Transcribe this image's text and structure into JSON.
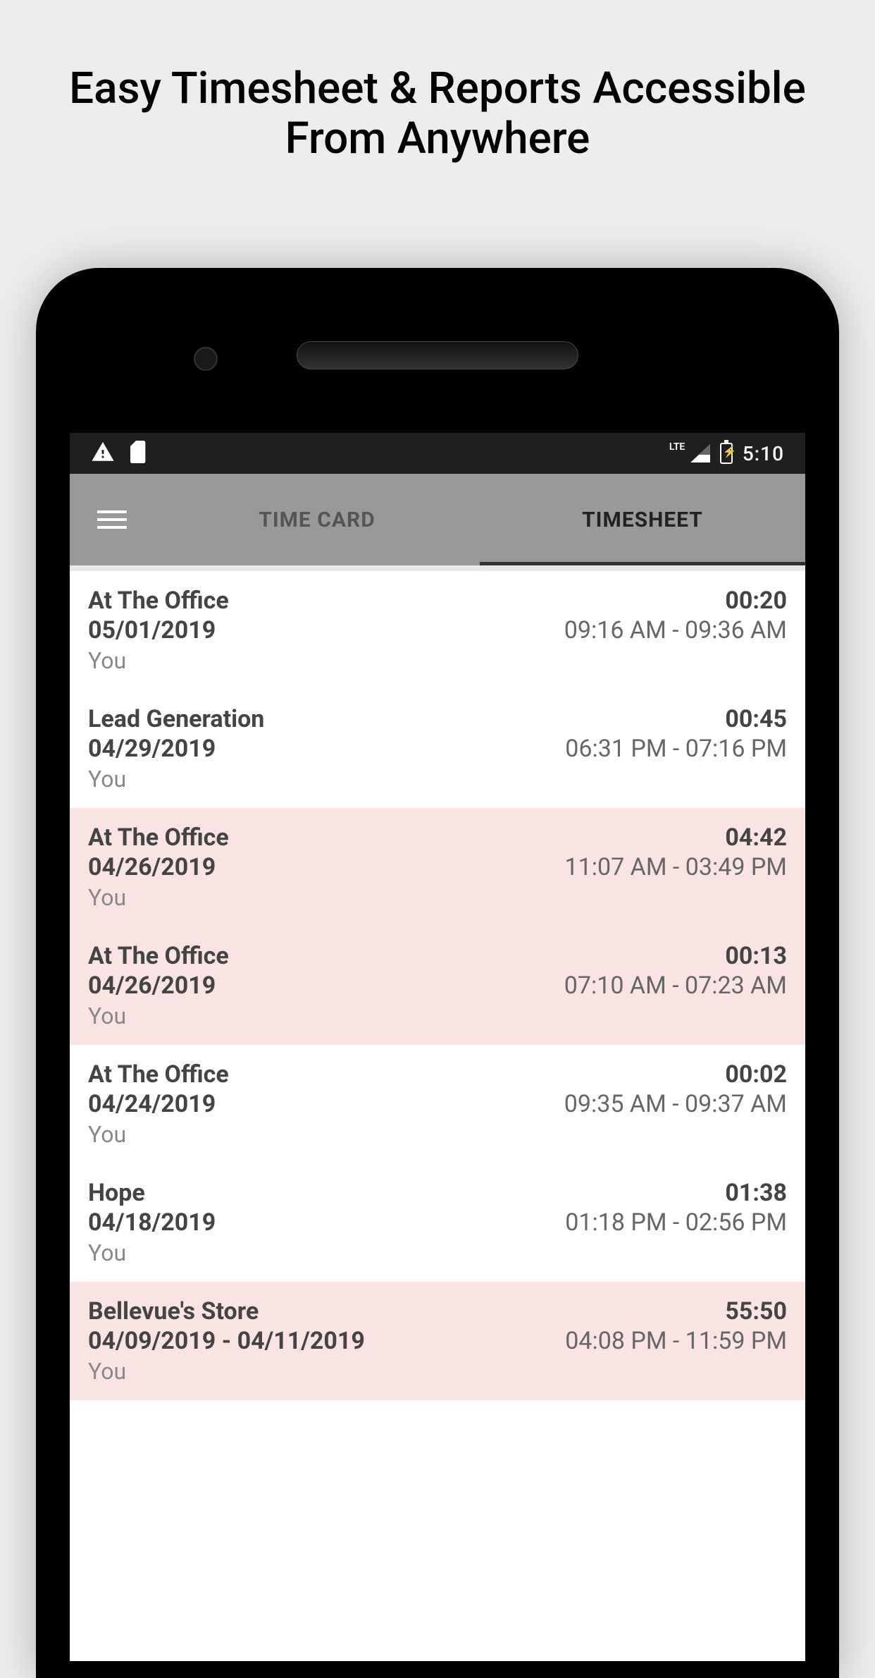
{
  "headline": "Easy Timesheet & Reports Accessible From Anywhere",
  "status_bar": {
    "clock": "5:10",
    "lte": "LTE"
  },
  "tabs": {
    "timecard": "TIME CARD",
    "timesheet": "TIMESHEET"
  },
  "entries": [
    {
      "title": "At The Office",
      "date": "05/01/2019",
      "user": "You",
      "duration": "00:20",
      "time_range": "09:16 AM - 09:36 AM",
      "highlighted": false
    },
    {
      "title": "Lead Generation",
      "date": "04/29/2019",
      "user": "You",
      "duration": "00:45",
      "time_range": "06:31 PM - 07:16 PM",
      "highlighted": false
    },
    {
      "title": "At The Office",
      "date": "04/26/2019",
      "user": "You",
      "duration": "04:42",
      "time_range": "11:07 AM - 03:49 PM",
      "highlighted": true
    },
    {
      "title": "At The Office",
      "date": "04/26/2019",
      "user": "You",
      "duration": "00:13",
      "time_range": "07:10 AM - 07:23 AM",
      "highlighted": true
    },
    {
      "title": "At The Office",
      "date": "04/24/2019",
      "user": "You",
      "duration": "00:02",
      "time_range": "09:35 AM - 09:37 AM",
      "highlighted": false
    },
    {
      "title": "Hope",
      "date": "04/18/2019",
      "user": "You",
      "duration": "01:38",
      "time_range": "01:18 PM - 02:56 PM",
      "highlighted": false
    },
    {
      "title": "Bellevue's Store",
      "date": "04/09/2019 - 04/11/2019",
      "user": "You",
      "duration": "55:50",
      "time_range": "04:08 PM - 11:59 PM",
      "highlighted": true
    }
  ]
}
